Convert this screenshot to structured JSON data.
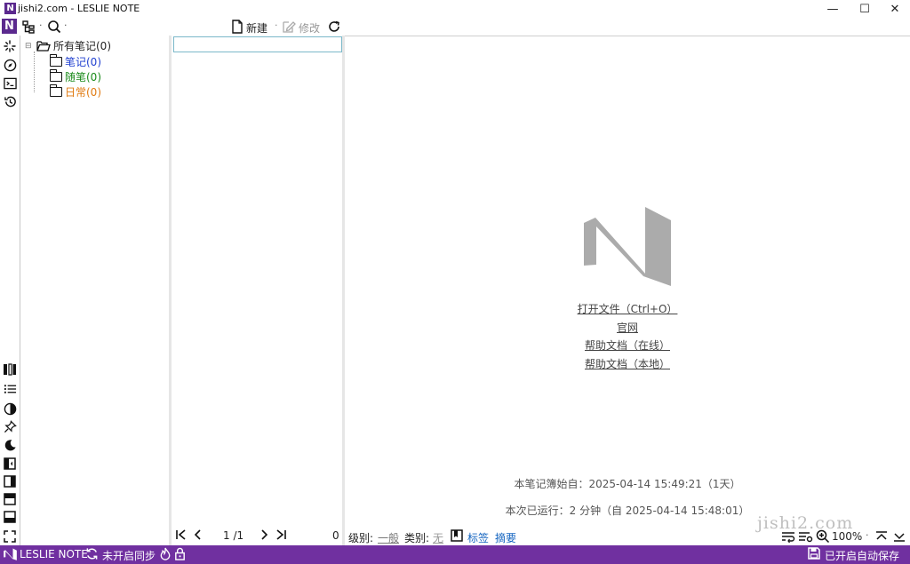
{
  "window": {
    "title": "jishi2.com - LESLIE NOTE",
    "logo_letter": "N",
    "minimize": "—",
    "maximize": "☐",
    "close": "✕"
  },
  "toolbar": {
    "new_label": "新建",
    "edit_label": "修改",
    "separator": "·"
  },
  "tree": {
    "root_label": "所有笔记(0)",
    "expander": "⊟",
    "children": [
      {
        "label": "笔记(0)",
        "color": "#1f3fd0"
      },
      {
        "label": "随笔(0)",
        "color": "#1a8a1a"
      },
      {
        "label": "日常(0)",
        "color": "#e07a10"
      }
    ]
  },
  "list": {
    "search_value": "",
    "page": "1 /1",
    "count": "0"
  },
  "home": {
    "links": [
      "打开文件（Ctrl+O）",
      "官网",
      "帮助文档（在线）",
      "帮助文档（本地）"
    ],
    "created_line": "本笔记簿始自：2025-04-14 15:49:21（1天）",
    "runtime_line": "本次已运行：2 分钟（自 2025-04-14 15:48:01）",
    "watermark": "jishi2.com",
    "logo_color": "#ababab"
  },
  "content_bottom": {
    "level_label": "级别:",
    "level_value": "一般",
    "category_label": "类别:",
    "category_value": "无",
    "tag_label": "标签",
    "summary_label": "摘要",
    "zoom": "100%",
    "dot": "·"
  },
  "status": {
    "app_name": "LESLIE NOTE",
    "sync_text": "未开启同步",
    "autosave_text": "已开启自动保存",
    "bar_color": "#7030a0"
  },
  "icons": [
    "app-logo-icon",
    "tree-view-icon",
    "search-icon",
    "new-doc-icon",
    "edit-doc-icon",
    "refresh-icon",
    "sparkle-icon",
    "compass-icon",
    "terminal-icon",
    "history-icon",
    "columns-icon",
    "list-icon",
    "contrast-icon",
    "pin-icon",
    "moon-icon",
    "panel-left-icon",
    "panel-right-icon",
    "panel-top-icon",
    "panel-bottom-icon",
    "fullscreen-icon",
    "first-page-icon",
    "prev-page-icon",
    "next-page-icon",
    "last-page-icon",
    "bookmark-icon",
    "wrap-icon",
    "settings-list-icon",
    "zoom-icon",
    "collapse-up-icon",
    "expand-down-icon",
    "sync-icon",
    "fire-icon",
    "lock-icon",
    "save-icon"
  ]
}
